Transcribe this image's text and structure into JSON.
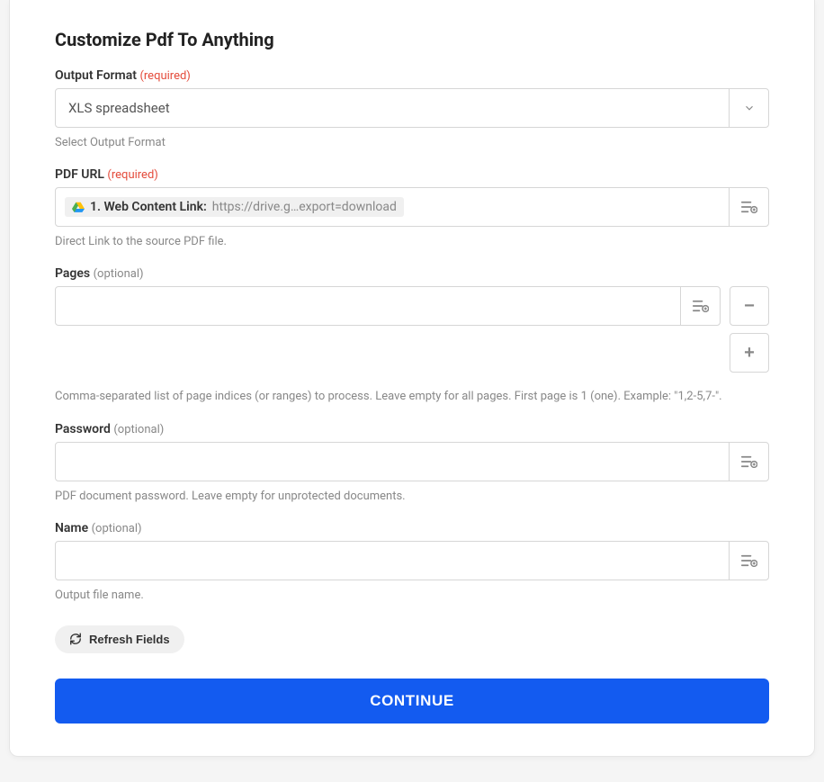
{
  "title": "Customize Pdf To Anything",
  "fields": {
    "output_format": {
      "label": "Output Format",
      "tag": "(required)",
      "value": "XLS spreadsheet",
      "helper": "Select Output Format"
    },
    "pdf_url": {
      "label": "PDF URL",
      "tag": "(required)",
      "token_label": "1. Web Content Link:",
      "token_url": "https://drive.g…export=download",
      "helper": "Direct Link to the source PDF file."
    },
    "pages": {
      "label": "Pages",
      "tag": "(optional)",
      "value": "",
      "helper": "Comma-separated list of page indices (or ranges) to process. Leave empty for all pages. First page is 1 (one). Example: \"1,2-5,7-\"."
    },
    "password": {
      "label": "Password",
      "tag": "(optional)",
      "value": "",
      "helper": "PDF document password. Leave empty for unprotected documents."
    },
    "name": {
      "label": "Name",
      "tag": "(optional)",
      "value": "",
      "helper": "Output file name."
    }
  },
  "buttons": {
    "refresh": "Refresh Fields",
    "continue": "CONTINUE",
    "minus": "−",
    "plus": "+"
  }
}
